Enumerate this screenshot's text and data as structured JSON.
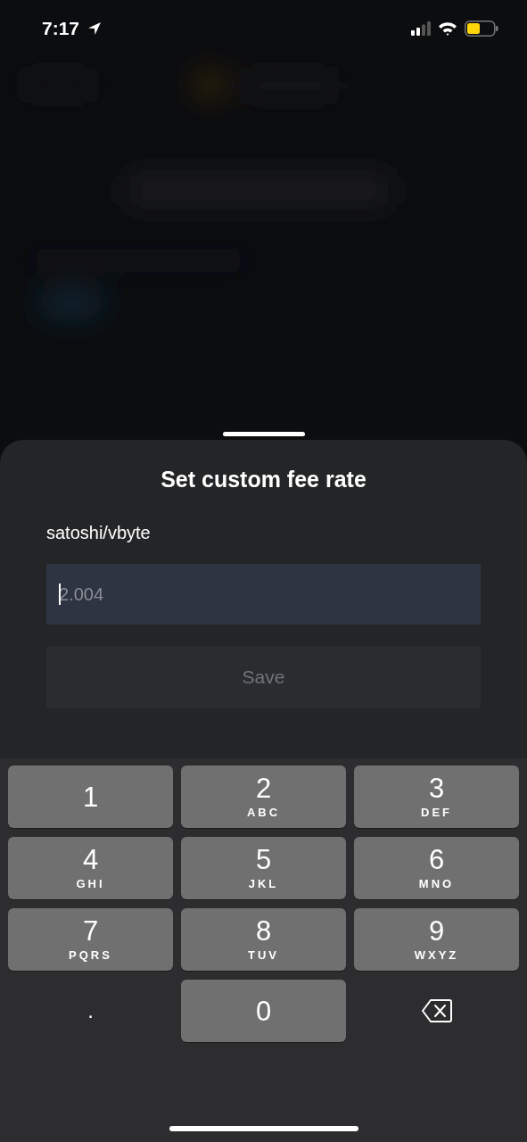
{
  "status_bar": {
    "time": "7:17"
  },
  "sheet": {
    "title": "Set custom fee rate",
    "unit_label": "satoshi/vbyte",
    "fee_field": {
      "placeholder": "2.004",
      "focused": true
    },
    "save_button": {
      "label": "Save",
      "disabled": true
    }
  },
  "keypad": [
    {
      "kind": "digit",
      "digit": "1"
    },
    {
      "kind": "digit",
      "digit": "2",
      "letters": "ABC"
    },
    {
      "kind": "digit",
      "digit": "3",
      "letters": "DEF"
    },
    {
      "kind": "digit",
      "digit": "4",
      "letters": "GHI"
    },
    {
      "kind": "digit",
      "digit": "5",
      "letters": "JKL"
    },
    {
      "kind": "digit",
      "digit": "6",
      "letters": "MNO"
    },
    {
      "kind": "digit",
      "digit": "7",
      "letters": "PQRS"
    },
    {
      "kind": "digit",
      "digit": "8",
      "letters": "TUV"
    },
    {
      "kind": "digit",
      "digit": "9",
      "letters": "WXYZ"
    },
    {
      "kind": "symbol",
      "label": "."
    },
    {
      "kind": "digit",
      "digit": "0"
    },
    {
      "kind": "delete"
    }
  ]
}
